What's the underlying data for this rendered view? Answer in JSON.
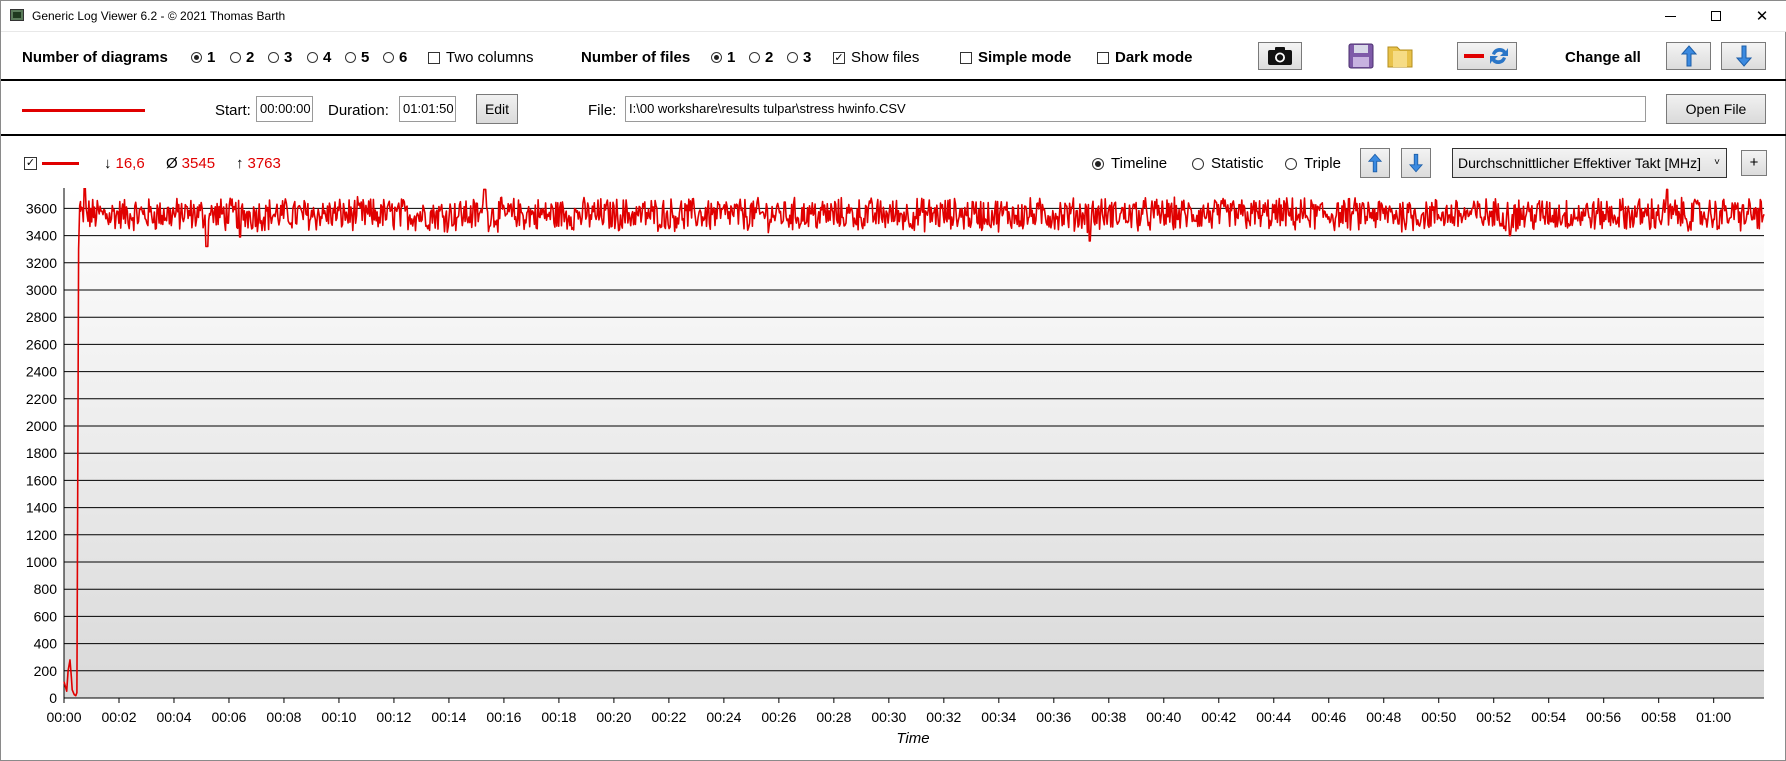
{
  "window": {
    "title": "Generic Log Viewer 6.2 - © 2021 Thomas Barth",
    "minimize_icon": "minimize-icon",
    "maximize_icon": "maximize-icon",
    "close_icon": "close-icon",
    "close_glyph": "✕"
  },
  "toolbar": {
    "diagrams_label": "Number of diagrams",
    "diagram_options": [
      "1",
      "2",
      "3",
      "4",
      "5",
      "6"
    ],
    "diagram_selected": "1",
    "two_columns_label": "Two columns",
    "two_columns_checked": false,
    "files_label": "Number of files",
    "file_options": [
      "1",
      "2",
      "3"
    ],
    "file_selected": "1",
    "show_files_label": "Show files",
    "show_files_checked": true,
    "simple_mode_label": "Simple mode",
    "simple_mode_checked": false,
    "dark_mode_label": "Dark mode",
    "dark_mode_checked": false,
    "screenshot_icon": "camera-icon",
    "save_icon": "floppy-disk-icon",
    "open_folder_icon": "folder-icon",
    "swap_color_icon": "refresh-color-icon",
    "change_all_label": "Change all",
    "up_icon": "arrow-up-icon",
    "down_icon": "arrow-down-icon",
    "check_glyph": "✓"
  },
  "file_row": {
    "line_color": "#e00000",
    "start_label": "Start:",
    "start_value": "00:00:00",
    "duration_label": "Duration:",
    "duration_value": "01:01:50",
    "edit_label": "Edit",
    "file_label": "File:",
    "file_path": "I:\\00 workshare\\results tulpar\\stress hwinfo.CSV",
    "open_file_label": "Open File"
  },
  "chart_header": {
    "series_checked": true,
    "series_color": "#e00000",
    "min_symbol": "↓",
    "min_value": "16,6",
    "avg_symbol": "Ø",
    "avg_value": "3545",
    "max_symbol": "↑",
    "max_value": "3763",
    "view_options": [
      "Timeline",
      "Statistic",
      "Triple"
    ],
    "view_selected": "Timeline",
    "channel": "Durchschnittlicher Effektiver Takt [MHz]",
    "channel_chevron": "˅",
    "add_label": "+"
  },
  "chart_data": {
    "type": "line",
    "xlabel": "Time",
    "ylabel": "",
    "x_range_minutes": [
      0,
      61.83
    ],
    "ylim": [
      0,
      3750
    ],
    "y_ticks": [
      0,
      200,
      400,
      600,
      800,
      1000,
      1200,
      1400,
      1600,
      1800,
      2000,
      2200,
      2400,
      2600,
      2800,
      3000,
      3200,
      3400,
      3600
    ],
    "x_tick_labels": [
      "00:00",
      "00:02",
      "00:04",
      "00:06",
      "00:08",
      "00:10",
      "00:12",
      "00:14",
      "00:16",
      "00:18",
      "00:20",
      "00:22",
      "00:24",
      "00:26",
      "00:28",
      "00:30",
      "00:32",
      "00:34",
      "00:36",
      "00:38",
      "00:40",
      "00:42",
      "00:44",
      "00:46",
      "00:48",
      "00:50",
      "00:52",
      "00:54",
      "00:56",
      "00:58",
      "01:00"
    ],
    "grid": true,
    "series": [
      {
        "color": "#e00000",
        "min": 16.6,
        "avg": 3545,
        "max": 3763,
        "startup": [
          [
            0.0,
            120
          ],
          [
            0.1,
            50
          ],
          [
            0.15,
            200
          ],
          [
            0.22,
            280
          ],
          [
            0.27,
            150
          ],
          [
            0.3,
            60
          ],
          [
            0.37,
            25
          ],
          [
            0.43,
            16.6
          ],
          [
            0.47,
            40
          ],
          [
            0.5,
            1500
          ],
          [
            0.53,
            3300
          ],
          [
            0.57,
            3620
          ],
          [
            0.6,
            3650
          ]
        ],
        "steady_minutes": [
          0.6,
          61.83
        ],
        "steady_samples": 1800,
        "steady_level": 3555,
        "steady_spread": 110,
        "dips": [
          [
            5.2,
            3320
          ],
          [
            6.4,
            3390
          ],
          [
            37.3,
            3360
          ],
          [
            52.6,
            3400
          ]
        ],
        "peaks": [
          [
            0.75,
            3763
          ],
          [
            15.3,
            3740
          ],
          [
            58.3,
            3740
          ]
        ]
      }
    ]
  }
}
